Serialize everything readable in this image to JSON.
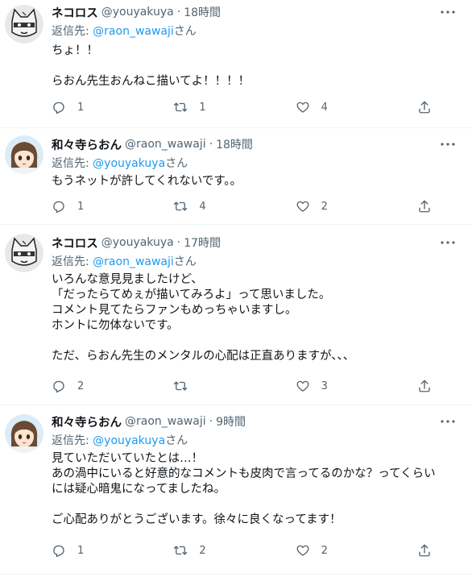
{
  "tweets": [
    {
      "name": "ネコロス",
      "handle": "@youyakuya",
      "time": "18時間",
      "reply_prefix": "返信先: ",
      "reply_mention": "@raon_wawaji",
      "reply_suffix": "さん",
      "lines": [
        "ちょ！！",
        "",
        "らおん先生おんねこ描いてよ！！！！"
      ],
      "replies": "1",
      "retweets": "1",
      "likes": "4",
      "avatar": "cat-mask-avatar"
    },
    {
      "name": "和々寺らおん",
      "handle": "@raon_wawaji",
      "time": "18時間",
      "reply_prefix": "返信先: ",
      "reply_mention": "@youyakuya",
      "reply_suffix": "さん",
      "lines": [
        "もうネットが許してくれないです。。"
      ],
      "replies": "1",
      "retweets": "4",
      "likes": "2",
      "avatar": "anime-girl-avatar"
    },
    {
      "name": "ネコロス",
      "handle": "@youyakuya",
      "time": "17時間",
      "reply_prefix": "返信先: ",
      "reply_mention": "@raon_wawaji",
      "reply_suffix": "さん",
      "lines": [
        "いろんな意見見ましたけど、",
        "「だったらてめぇが描いてみろよ」って思いました。",
        "コメント見てたらファンもめっちゃいますし。",
        "ホントに勿体ないです。",
        "",
        "ただ、らおん先生のメンタルの心配は正直ありますが、、、"
      ],
      "replies": "2",
      "retweets": "",
      "likes": "3",
      "avatar": "cat-mask-avatar"
    },
    {
      "name": "和々寺らおん",
      "handle": "@raon_wawaji",
      "time": "9時間",
      "reply_prefix": "返信先: ",
      "reply_mention": "@youyakuya",
      "reply_suffix": "さん",
      "lines": [
        "見ていただいていたとは…！",
        "あの渦中にいると好意的なコメントも皮肉で言ってるのかな？ってくらい",
        "には疑心暗鬼になってましたね。",
        "",
        "ご心配ありがとうございます。徐々に良くなってます！"
      ],
      "replies": "1",
      "retweets": "2",
      "likes": "2",
      "avatar": "anime-girl-avatar"
    }
  ],
  "colors": {
    "text": "#0f1419",
    "muted": "#536471",
    "link": "#1d9bf0",
    "divider": "#eff3f4"
  }
}
